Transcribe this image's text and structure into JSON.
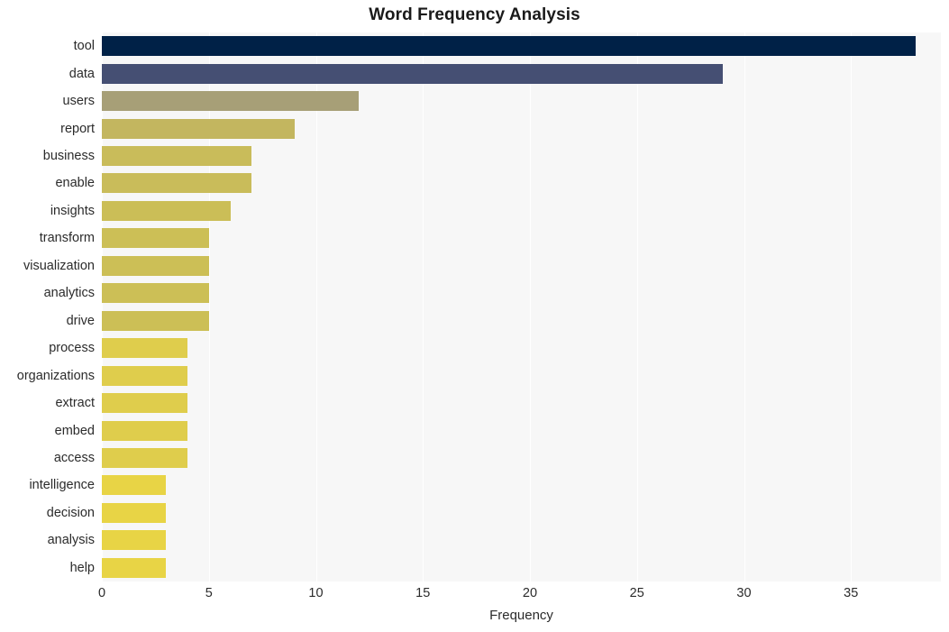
{
  "chart_data": {
    "type": "bar",
    "orientation": "horizontal",
    "title": "Word Frequency Analysis",
    "xlabel": "Frequency",
    "ylabel": "",
    "categories": [
      "tool",
      "data",
      "users",
      "report",
      "business",
      "enable",
      "insights",
      "transform",
      "visualization",
      "analytics",
      "drive",
      "process",
      "organizations",
      "extract",
      "embed",
      "access",
      "intelligence",
      "decision",
      "analysis",
      "help"
    ],
    "values": [
      38,
      29,
      12,
      9,
      7,
      7,
      6,
      5,
      5,
      5,
      5,
      4,
      4,
      4,
      4,
      4,
      3,
      3,
      3,
      3
    ],
    "bar_colors": [
      "#002147",
      "#454f73",
      "#a79f77",
      "#c3b65f",
      "#c9bc5a",
      "#c9bc5a",
      "#cbbe57",
      "#ccbf56",
      "#ccbf56",
      "#ccbf56",
      "#ccbf56",
      "#dfcd4c",
      "#dfcd4c",
      "#dfcd4c",
      "#dfcd4c",
      "#dfcd4c",
      "#e8d445",
      "#e8d445",
      "#e8d445",
      "#e8d445"
    ],
    "xlim": [
      0,
      39.2
    ],
    "x_ticks": [
      0,
      5,
      10,
      15,
      20,
      25,
      30,
      35
    ],
    "x_tick_labels": [
      "0",
      "5",
      "10",
      "15",
      "20",
      "25",
      "30",
      "35"
    ],
    "grid": true,
    "grid_axis": "x",
    "legend": null,
    "plot_background": "#f7f7f7",
    "figure_background": "#ffffff"
  }
}
